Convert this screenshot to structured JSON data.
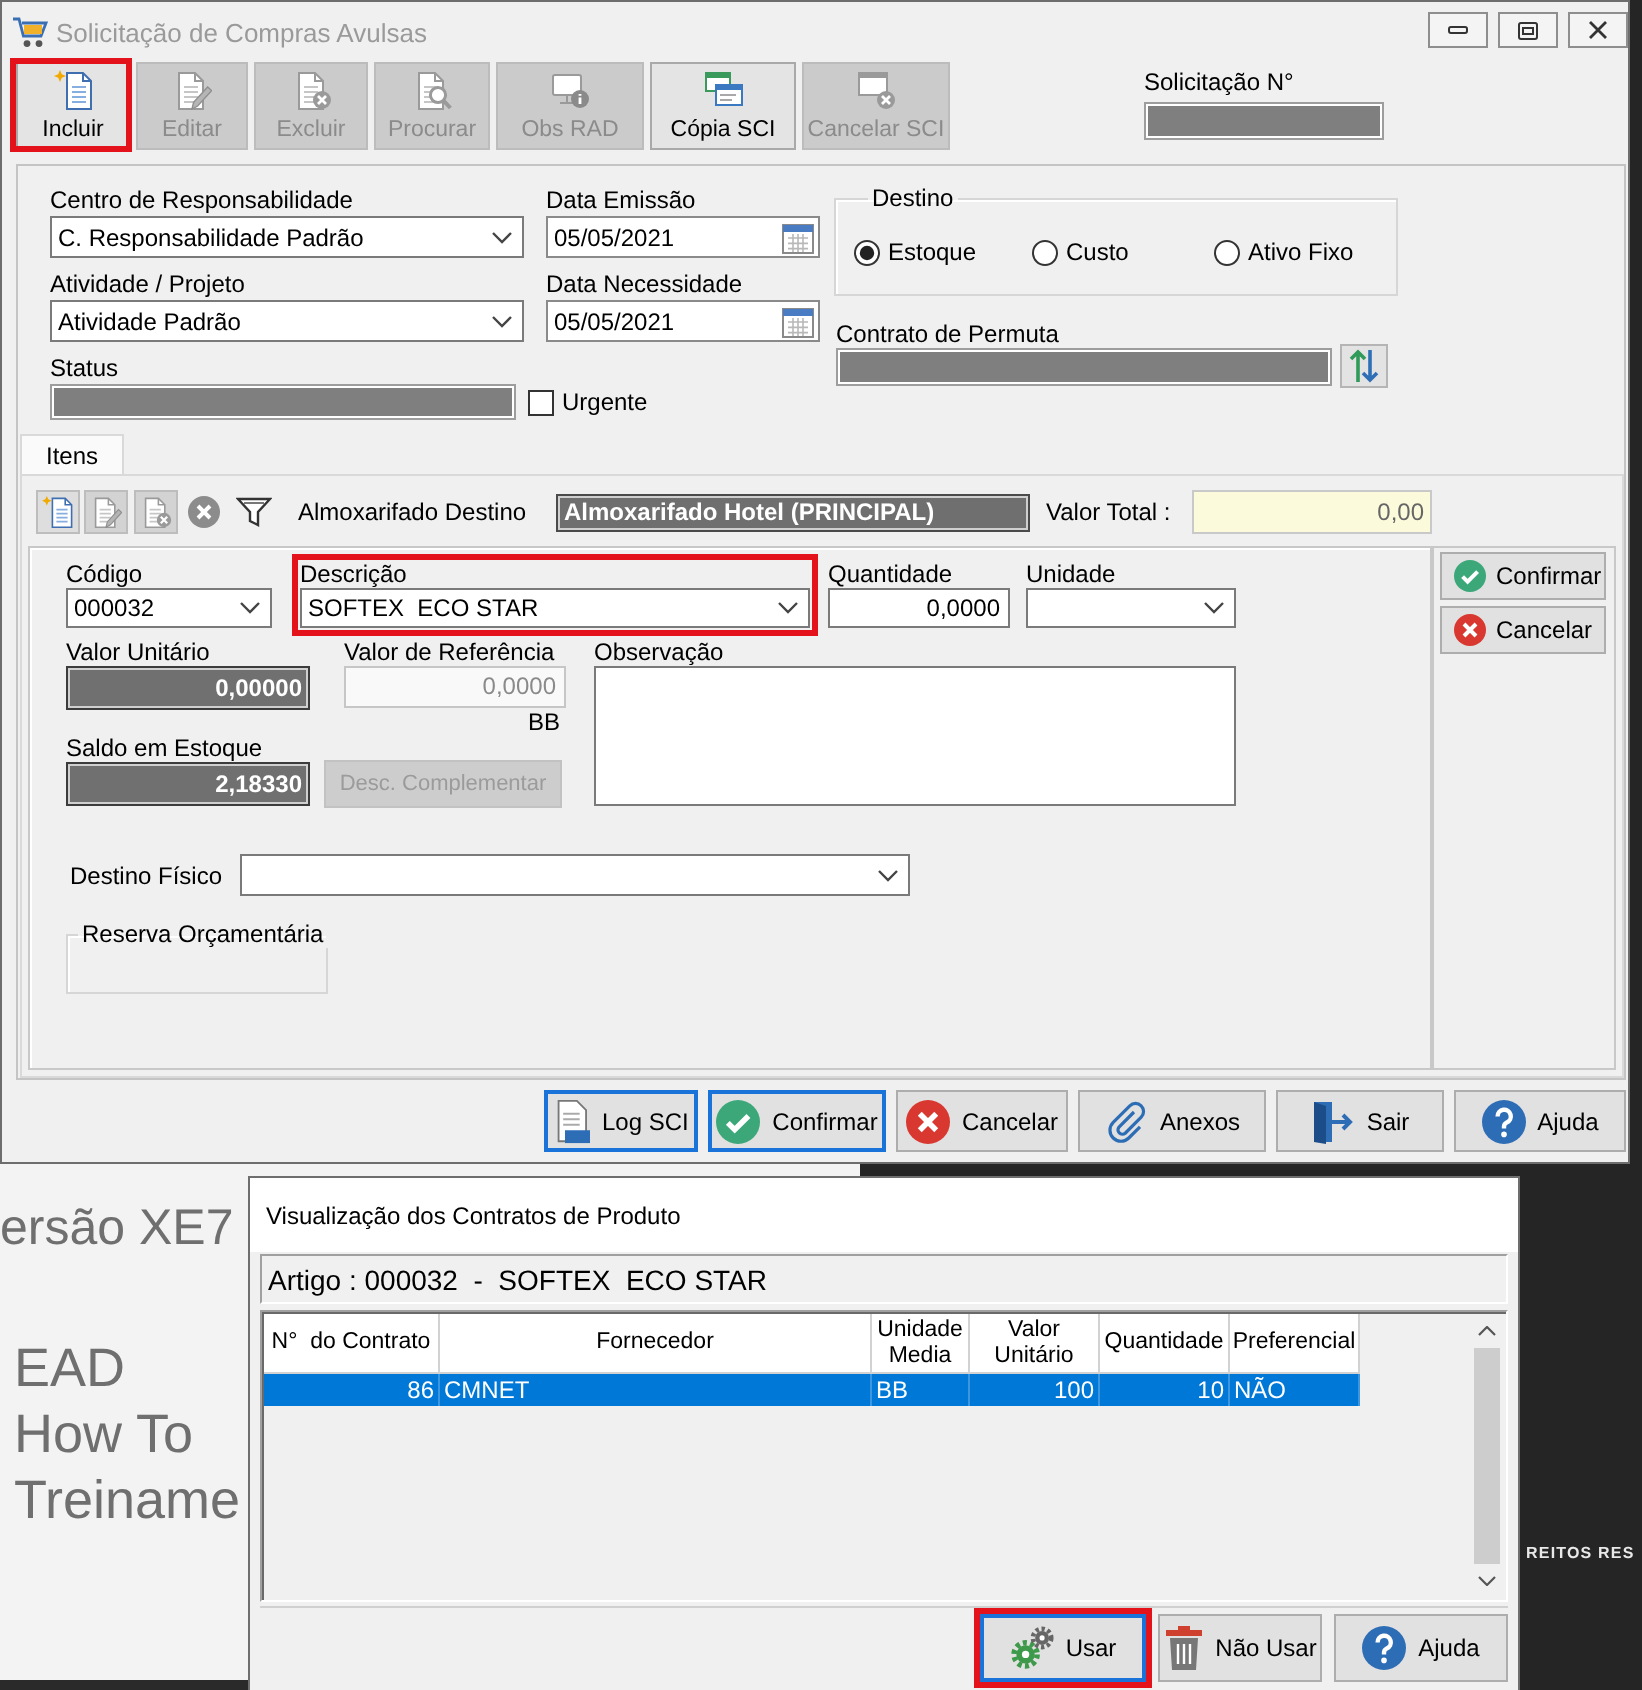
{
  "backdrop": {
    "version": "ersão XE7",
    "lines": [
      "EAD",
      "How To",
      "Treiname"
    ],
    "footer": "REITOS RES"
  },
  "window": {
    "title": "Solicitação de Compras Avulsas"
  },
  "toolbar": [
    {
      "label": "Incluir",
      "kind": "new",
      "disabled": false,
      "highlighted": true
    },
    {
      "label": "Editar",
      "kind": "edit",
      "disabled": true,
      "highlighted": false
    },
    {
      "label": "Excluir",
      "kind": "delete",
      "disabled": true,
      "highlighted": false
    },
    {
      "label": "Procurar",
      "kind": "search",
      "disabled": true,
      "highlighted": false
    },
    {
      "label": "Obs RAD",
      "kind": "note",
      "disabled": true,
      "highlighted": false
    },
    {
      "label": "Cópia SCI",
      "kind": "copy",
      "disabled": false,
      "highlighted": false
    },
    {
      "label": "Cancelar SCI",
      "kind": "cancel",
      "disabled": true,
      "highlighted": false
    }
  ],
  "request_number": {
    "label": "Solicitação N°"
  },
  "header": {
    "centro": {
      "label": "Centro de Responsabilidade",
      "value": "C. Responsabilidade Padrão"
    },
    "data_emissao": {
      "label": "Data Emissão",
      "value": "05/05/2021"
    },
    "atividade": {
      "label": "Atividade / Projeto",
      "value": "Atividade Padrão"
    },
    "data_necessidade": {
      "label": "Data Necessidade",
      "value": "05/05/2021"
    },
    "status": {
      "label": "Status"
    },
    "urgente": {
      "label": "Urgente",
      "checked": false
    },
    "destino": {
      "legend": "Destino",
      "options": [
        {
          "label": "Estoque",
          "selected": true
        },
        {
          "label": "Custo",
          "selected": false
        },
        {
          "label": "Ativo Fixo",
          "selected": false
        }
      ]
    },
    "contrato_permuta": {
      "label": "Contrato de Permuta"
    }
  },
  "tabs": [
    {
      "label": "Itens",
      "selected": true
    }
  ],
  "items_toolbar": {
    "buttons": [
      {
        "kind": "new",
        "disabled": false
      },
      {
        "kind": "edit",
        "disabled": true
      },
      {
        "kind": "delete",
        "disabled": true
      },
      {
        "kind": "clear",
        "disabled": true
      },
      {
        "kind": "filter",
        "disabled": false
      }
    ],
    "almoxarifado": {
      "label": "Almoxarifado Destino",
      "value": "Almoxarifado Hotel (PRINCIPAL)"
    },
    "valor_total": {
      "label": "Valor Total :",
      "value": "0,00"
    }
  },
  "item_form": {
    "codigo": {
      "label": "Código",
      "value": "000032"
    },
    "descricao": {
      "label": "Descrição",
      "value": "SOFTEX  ECO STAR",
      "highlighted": true
    },
    "quantidade": {
      "label": "Quantidade",
      "value": "0,0000"
    },
    "unidade": {
      "label": "Unidade"
    },
    "valor_unitario": {
      "label": "Valor Unitário",
      "value": "0,00000"
    },
    "valor_referencia": {
      "label": "Valor de Referência",
      "value": "0,0000",
      "unit": "BB"
    },
    "observacao": {
      "label": "Observação"
    },
    "saldo_estoque": {
      "label": "Saldo em Estoque",
      "value": "2,18330"
    },
    "desc_complementar": {
      "label": "Desc. Complementar",
      "disabled": true
    },
    "destino_fisico": {
      "label": "Destino Físico"
    },
    "reserva": {
      "legend": "Reserva Orçamentária"
    }
  },
  "item_actions": [
    {
      "label": "Confirmar",
      "kind": "confirm"
    },
    {
      "label": "Cancelar",
      "kind": "cancel"
    }
  ],
  "footer_buttons": [
    {
      "label": "Log SCI",
      "kind": "log",
      "focused": true
    },
    {
      "label": "Confirmar",
      "kind": "confirm",
      "focused": true
    },
    {
      "label": "Cancelar",
      "kind": "cancel",
      "focused": false
    },
    {
      "label": "Anexos",
      "kind": "attach",
      "focused": false
    },
    {
      "label": "Sair",
      "kind": "exit",
      "focused": false
    },
    {
      "label": "Ajuda",
      "kind": "help",
      "focused": false
    }
  ],
  "dialog": {
    "title": "Visualização dos Contratos de Produto",
    "article": "Artigo : 000032  -  SOFTEX  ECO STAR",
    "table": {
      "columns": [
        "N°  do Contrato",
        "Fornecedor",
        "Unidade Media",
        "Valor Unitário",
        "Quantidade",
        "Preferencial"
      ],
      "rows": [
        {
          "cells": [
            "86",
            "CMNET",
            "BB",
            "100",
            "10",
            "NÃO"
          ],
          "selected": true
        }
      ]
    },
    "buttons": [
      {
        "label": "Usar",
        "kind": "use",
        "focused": true,
        "highlighted": true
      },
      {
        "label": "Não Usar",
        "kind": "discard",
        "focused": false,
        "highlighted": false
      },
      {
        "label": "Ajuda",
        "kind": "help",
        "focused": false,
        "highlighted": false
      }
    ]
  }
}
